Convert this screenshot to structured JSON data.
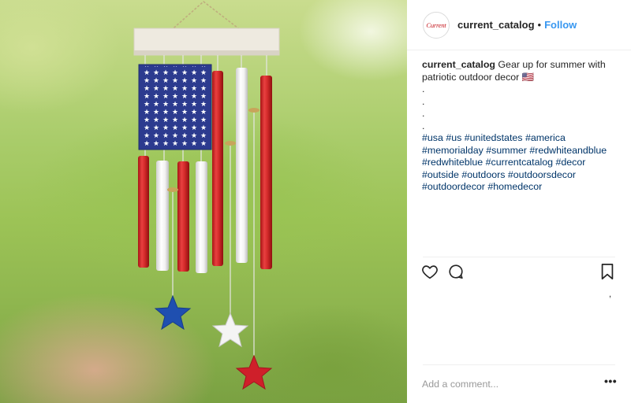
{
  "post": {
    "image_alt": "Patriotic flag wind chime with red, white and blue stars",
    "header": {
      "avatar_text": "Current",
      "username": "current_catalog",
      "separator": "•",
      "follow_label": "Follow"
    },
    "caption": {
      "username": "current_catalog",
      "text": "Gear up for summer with patriotic outdoor decor",
      "emoji": "🇺🇸",
      "dot_lines": [
        ".",
        ".",
        ".",
        "."
      ],
      "hashtags": [
        "#usa",
        "#us",
        "#unitedstates",
        "#america",
        "#memorialday",
        "#summer",
        "#redwhiteandblue",
        "#redwhiteblue",
        "#currentcatalog",
        "#decor",
        "#outside",
        "#outdoors",
        "#outdoorsdecor",
        "#outdoordecor",
        "#homedecor"
      ]
    },
    "actions": {
      "like_icon": "heart-icon",
      "comment_icon": "comment-bubble-icon",
      "save_icon": "bookmark-icon",
      "likes_placeholder": ","
    },
    "comment": {
      "placeholder": "Add a comment...",
      "more_label": "•••"
    }
  },
  "colors": {
    "link_blue": "#3897f0",
    "hashtag_blue": "#003569",
    "flag_red": "#d42a2a",
    "flag_blue": "#2c3b8f",
    "text": "#262626",
    "muted": "#999999"
  }
}
